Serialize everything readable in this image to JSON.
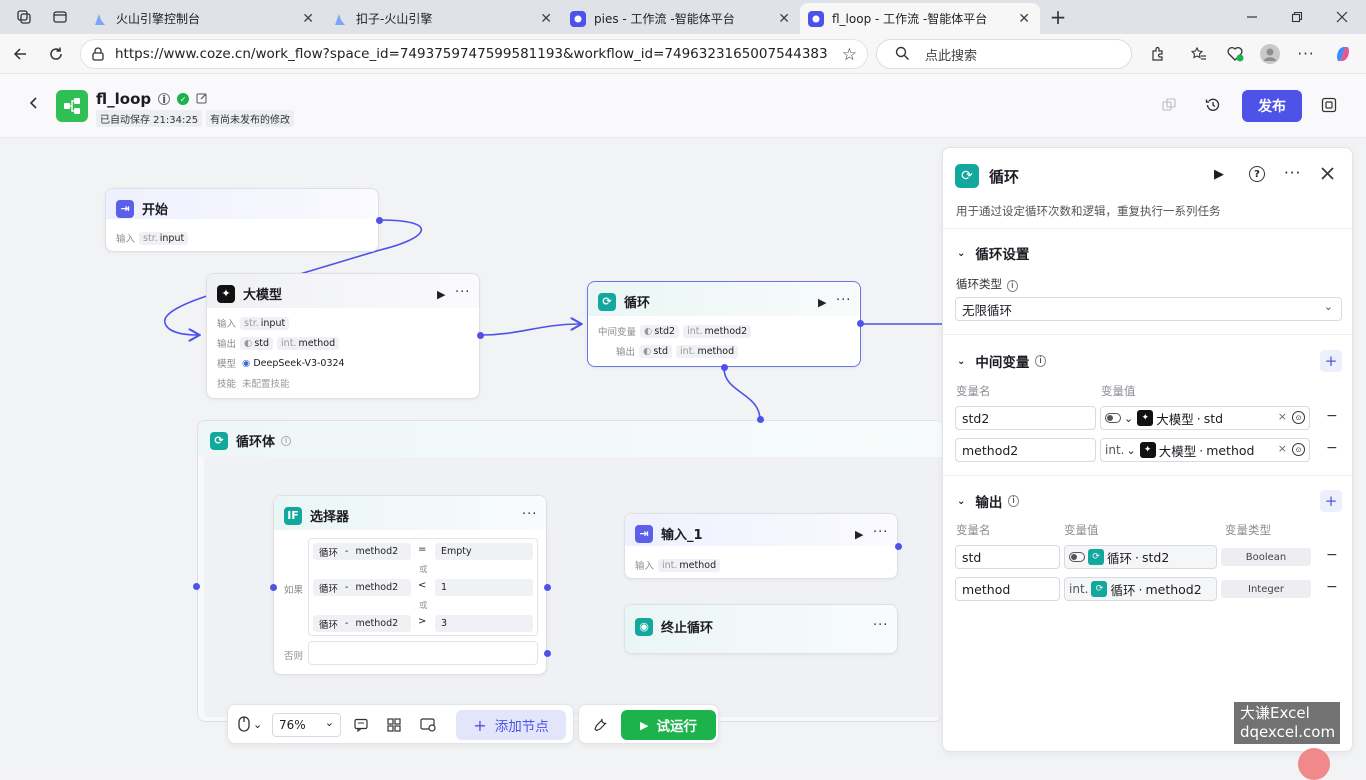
{
  "browser": {
    "tabs": [
      {
        "label": "火山引擎控制台"
      },
      {
        "label": "扣子-火山引擎"
      },
      {
        "label": "pies - 工作流 -智能体平台"
      },
      {
        "label": "fl_loop - 工作流 -智能体平台"
      }
    ],
    "url": "https://www.coze.cn/work_flow?space_id=7493759747599581193&workflow_id=7496323165007544383",
    "search_placeholder": "点此搜索"
  },
  "header": {
    "title": "fl_loop",
    "autosave": "已自动保存 21:34:25",
    "unpublished": "有尚未发布的修改",
    "publish_label": "发布"
  },
  "nodes": {
    "start": {
      "title": "开始",
      "input_label": "输入",
      "input_type": "str.",
      "input_name": "input"
    },
    "llm": {
      "title": "大模型",
      "input_label": "输入",
      "input_type": "str.",
      "input_name": "input",
      "output_label": "输出",
      "out1_name": "std",
      "out2_type": "int.",
      "out2_name": "method",
      "model_label": "模型",
      "model_name": "DeepSeek-V3-0324",
      "skill_label": "技能",
      "skill_value": "未配置技能"
    },
    "loop": {
      "title": "循环",
      "mid_label": "中间变量",
      "mid1": "std2",
      "mid2_type": "int.",
      "mid2": "method2",
      "out_label": "输出",
      "out1": "std",
      "out2_type": "int.",
      "out2": "method"
    },
    "loop_body": {
      "title": "循环体"
    },
    "selector": {
      "title": "选择器",
      "if_label": "如果",
      "else_label": "否则",
      "or_label": "或",
      "conditions": [
        {
          "left_node": "循环",
          "left_var": "method2",
          "op": "=",
          "right": "Empty"
        },
        {
          "left_node": "循环",
          "left_var": "method2",
          "op": "<",
          "right": "1"
        },
        {
          "left_node": "循环",
          "left_var": "method2",
          "op": ">",
          "right": "3"
        }
      ]
    },
    "input1": {
      "title": "输入_1",
      "input_label": "输入",
      "input_type": "int.",
      "input_name": "method"
    },
    "break": {
      "title": "终止循环"
    }
  },
  "panel": {
    "title": "循环",
    "description": "用于通过设定循环次数和逻辑，重复执行一系列任务",
    "loop_settings": {
      "title": "循环设置",
      "type_label": "循环类型",
      "type_value": "无限循环"
    },
    "mid_vars": {
      "title": "中间变量",
      "col_name": "变量名",
      "col_value": "变量值",
      "rows": [
        {
          "name": "std2",
          "type": "",
          "ref_node": "大模型",
          "ref_var": "std"
        },
        {
          "name": "method2",
          "type": "int.",
          "ref_node": "大模型",
          "ref_var": "method"
        }
      ]
    },
    "outputs": {
      "title": "输出",
      "col_name": "变量名",
      "col_value": "变量值",
      "col_type": "变量类型",
      "rows": [
        {
          "name": "std",
          "type": "",
          "ref_node": "循环",
          "ref_var": "std2",
          "var_type": "Boolean"
        },
        {
          "name": "method",
          "type": "int.",
          "ref_node": "循环",
          "ref_var": "method2",
          "var_type": "Integer"
        }
      ]
    }
  },
  "toolbar": {
    "zoom": "76%",
    "add_node": "添加节点",
    "test_run": "试运行"
  },
  "watermark": {
    "line1": "大谦Excel",
    "line2": "dqexcel.com"
  },
  "colors": {
    "accent": "#4d53e8",
    "loop_teal": "#12a89e",
    "run_green": "#1db34c"
  }
}
